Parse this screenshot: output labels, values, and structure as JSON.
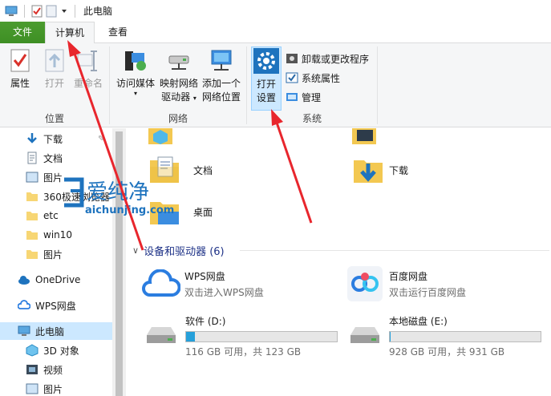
{
  "window": {
    "title": "此电脑"
  },
  "tabs": {
    "file": "文件",
    "computer": "计算机",
    "view": "查看"
  },
  "ribbon": {
    "location": {
      "label": "位置",
      "properties": "属性",
      "open": "打开",
      "rename": "重命名"
    },
    "network": {
      "label": "网络",
      "access_media": "访问媒体",
      "map_drive_line1": "映射网络",
      "map_drive_line2": "驱动器",
      "add_location_line1": "添加一个",
      "add_location_line2": "网络位置"
    },
    "system": {
      "label": "系统",
      "open_settings_line1": "打开",
      "open_settings_line2": "设置",
      "uninstall": "卸载或更改程序",
      "system_properties": "系统属性",
      "manage": "管理"
    }
  },
  "sidebar": {
    "items": [
      {
        "label": "下载"
      },
      {
        "label": "文档"
      },
      {
        "label": "图片"
      },
      {
        "label": "360极速浏览器"
      },
      {
        "label": "etc"
      },
      {
        "label": "win10"
      },
      {
        "label": "图片"
      },
      {
        "label": "OneDrive"
      },
      {
        "label": "WPS网盘"
      },
      {
        "label": "此电脑"
      },
      {
        "label": "3D 对象"
      },
      {
        "label": "视频"
      },
      {
        "label": "图片"
      }
    ]
  },
  "folders": {
    "documents": "文档",
    "downloads": "下载",
    "desktop": "桌面"
  },
  "devices": {
    "section_title": "设备和驱动器 (6)",
    "wps": {
      "name": "WPS网盘",
      "sub": "双击进入WPS网盘"
    },
    "baidu": {
      "name": "百度网盘",
      "sub": "双击运行百度网盘"
    },
    "drive_d": {
      "name": "软件 (D:)",
      "sub": "116 GB 可用，共 123 GB",
      "used_fraction": 0.057
    },
    "drive_e": {
      "name": "本地磁盘 (E:)",
      "sub": "928 GB 可用，共 931 GB",
      "used_fraction": 0.003
    }
  },
  "watermark": {
    "brand": "爱纯净",
    "url": "aichunjing.com"
  },
  "colors": {
    "accent": "#1e73be",
    "annotation_red": "#e8262d",
    "selection": "#cce8ff"
  }
}
